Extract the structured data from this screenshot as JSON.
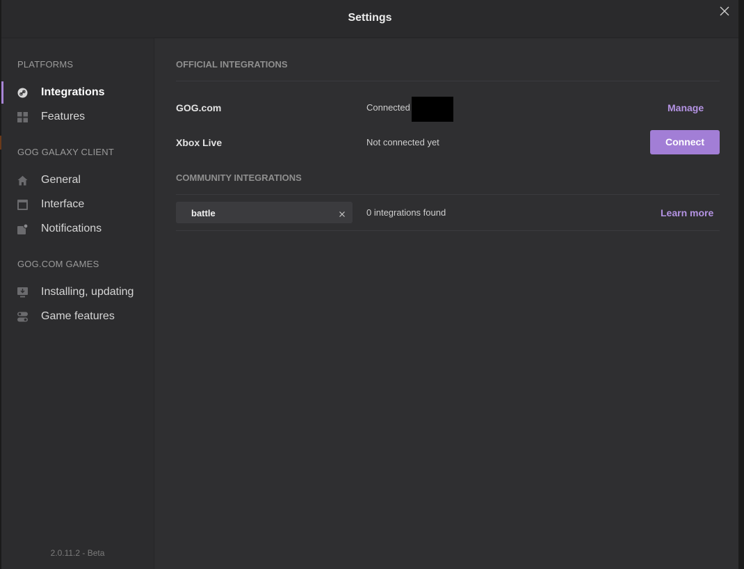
{
  "window": {
    "title": "Settings"
  },
  "sidebar": {
    "sections": [
      {
        "heading": "PLATFORMS",
        "items": [
          {
            "label": "Integrations",
            "icon": "link-icon",
            "active": true
          },
          {
            "label": "Features",
            "icon": "grid-icon"
          }
        ]
      },
      {
        "heading": "GOG GALAXY CLIENT",
        "items": [
          {
            "label": "General",
            "icon": "home-icon"
          },
          {
            "label": "Interface",
            "icon": "window-icon"
          },
          {
            "label": "Notifications",
            "icon": "notification-icon"
          }
        ]
      },
      {
        "heading": "GOG.COM GAMES",
        "items": [
          {
            "label": "Installing, updating",
            "icon": "download-icon"
          },
          {
            "label": "Game features",
            "icon": "toggles-icon"
          }
        ]
      }
    ],
    "version": "2.0.11.2 - Beta"
  },
  "main": {
    "official": {
      "heading": "OFFICIAL INTEGRATIONS",
      "rows": [
        {
          "name": "GOG.com",
          "status": "Connected",
          "action": "Manage"
        },
        {
          "name": "Xbox Live",
          "status": "Not connected yet",
          "action": "Connect"
        }
      ]
    },
    "community": {
      "heading": "COMMUNITY INTEGRATIONS",
      "search_value": "battle",
      "result_text": "0 integrations found",
      "learn_more": "Learn more"
    }
  },
  "colors": {
    "accent": "#a27ed6",
    "link": "#b493e3",
    "background": "#2f2f31",
    "sidebar": "#2c2c2e"
  }
}
